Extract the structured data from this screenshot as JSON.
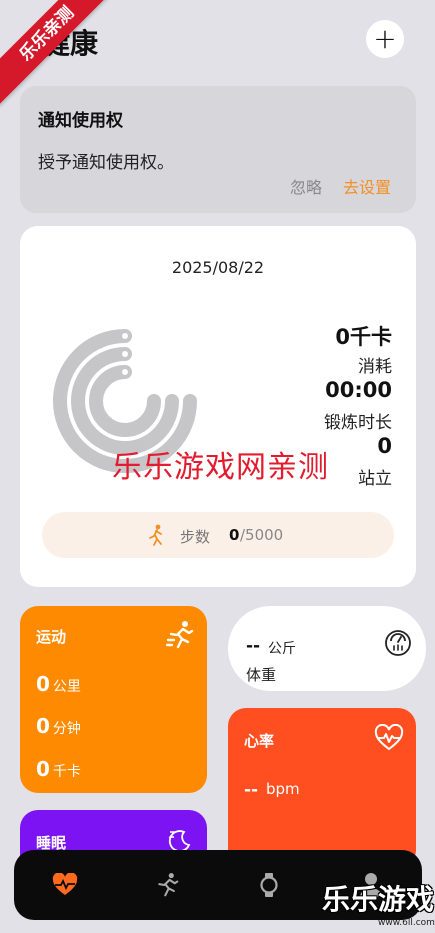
{
  "header": {
    "title": "健康",
    "add_icon": "plus-icon"
  },
  "notice": {
    "title": "通知使用权",
    "body": "授予通知使用权。",
    "ignore_label": "忽略",
    "setup_label": "去设置",
    "accent": "#f29025"
  },
  "activity": {
    "date": "2025/08/22",
    "calories_value": "0千卡",
    "calories_label": "消耗",
    "duration_value": "00:00",
    "duration_label": "锻炼时长",
    "stand_value": "0",
    "stand_label": "站立",
    "steps_label": "步数",
    "steps_current": "0",
    "steps_goal": "/5000",
    "steps_icon": "walking-icon"
  },
  "exercise": {
    "title": "运动",
    "icon": "running-icon",
    "rows": [
      {
        "value": "0",
        "unit": "公里"
      },
      {
        "value": "0",
        "unit": "分钟"
      },
      {
        "value": "0",
        "unit": "千卡"
      }
    ],
    "color": "#fd8a00"
  },
  "weight": {
    "value": "--",
    "unit": "公斤",
    "label": "体重",
    "icon": "scale-icon"
  },
  "heart": {
    "title": "心率",
    "value": "--",
    "unit": "bpm",
    "icon": "heartbeat-icon",
    "color": "#ff4e20"
  },
  "sleep": {
    "title": "睡眠",
    "icon": "moon-icon",
    "color": "#7b13f2"
  },
  "nav": {
    "items": [
      {
        "name": "health",
        "icon": "heart-pulse-icon",
        "active": true
      },
      {
        "name": "exercise",
        "icon": "running-icon",
        "active": false
      },
      {
        "name": "device",
        "icon": "watch-icon",
        "active": false
      },
      {
        "name": "profile",
        "icon": "person-icon",
        "active": false
      }
    ]
  },
  "watermarks": {
    "ribbon": "乐乐亲测",
    "center": "乐乐游戏网亲测",
    "corner": "乐乐游戏",
    "url": "www.6ll.com"
  }
}
